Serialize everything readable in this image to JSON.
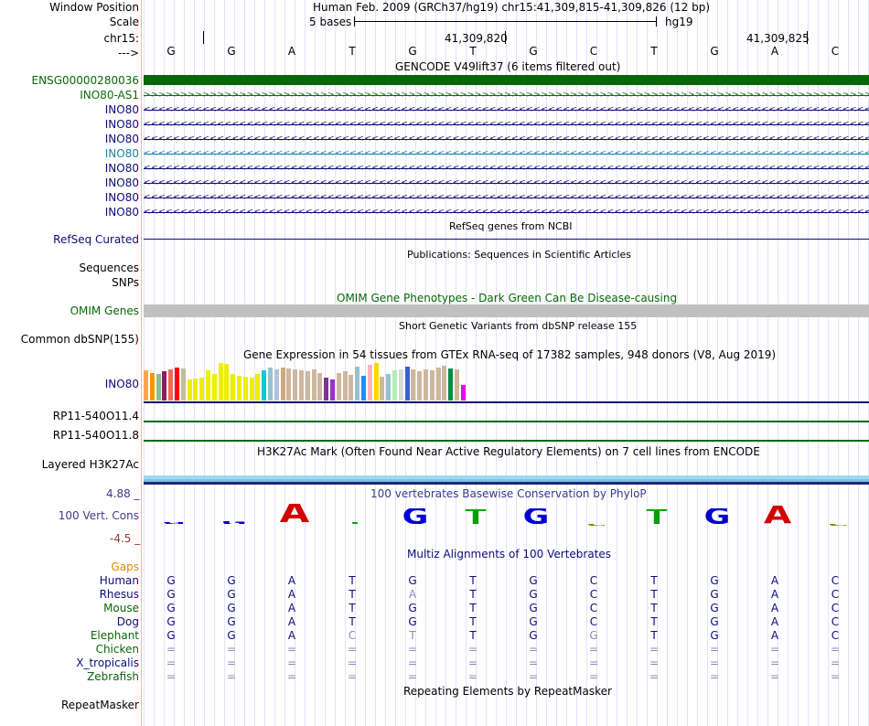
{
  "header": {
    "window_position_label": "Window Position",
    "scale_label": "Scale",
    "chrom_label": "chr15:",
    "arrow_label": "--->",
    "title": "Human Feb. 2009 (GRCh37/hg19)   chr15:41,309,815-41,309,826 (12 bp)",
    "scale_text": "5 bases",
    "assembly": "hg19",
    "pos1": "41,309,820",
    "pos2": "41,309,825"
  },
  "bases": [
    "G",
    "G",
    "A",
    "T",
    "G",
    "T",
    "G",
    "C",
    "T",
    "G",
    "A",
    "C"
  ],
  "gencode": {
    "title": "GENCODE V49lift37 (6 items filtered out)",
    "rows": [
      {
        "label": "ENSG00000280036",
        "color": "#086708",
        "style": "bar"
      },
      {
        "label": "INO80-AS1",
        "color": "#0c6c0c",
        "style": "fwd"
      },
      {
        "label": "INO80",
        "color": "#0c0c78",
        "style": "rev"
      },
      {
        "label": "INO80",
        "color": "#0c0c78",
        "style": "rev"
      },
      {
        "label": "INO80",
        "color": "#0c0c78",
        "style": "rev"
      },
      {
        "label": "INO80",
        "color": "#1686a6",
        "style": "rev"
      },
      {
        "label": "INO80",
        "color": "#0c0c78",
        "style": "rev"
      },
      {
        "label": "INO80",
        "color": "#0c0c78",
        "style": "rev"
      },
      {
        "label": "INO80",
        "color": "#0c0c78",
        "style": "rev"
      },
      {
        "label": "INO80",
        "color": "#0c0c78",
        "style": "rev"
      }
    ]
  },
  "refseq": {
    "title": "RefSeq genes from NCBI",
    "label": "RefSeq Curated"
  },
  "pubs": {
    "title": "Publications: Sequences in Scientific Articles",
    "label1": "Sequences",
    "label2": "SNPs"
  },
  "omim": {
    "title": "OMIM Gene Phenotypes - Dark Green Can Be Disease-causing",
    "label": "OMIM Genes"
  },
  "dbsnp": {
    "title": "Short Genetic Variants from dbSNP release 155",
    "label": "Common dbSNP(155)"
  },
  "gtex": {
    "title": "Gene Expression in 54 tissues from GTEx RNA-seq of 17382 samples, 948 donors (V8, Aug 2019)",
    "label": "INO80",
    "bars": [
      {
        "h": 0.78,
        "c": "#ffa54f"
      },
      {
        "h": 0.72,
        "c": "#ee9a00"
      },
      {
        "h": 0.68,
        "c": "#8fbc8f"
      },
      {
        "h": 0.75,
        "c": "#8b1c62"
      },
      {
        "h": 0.8,
        "c": "#ee6a50"
      },
      {
        "h": 0.85,
        "c": "#ff0000"
      },
      {
        "h": 0.83,
        "c": "#cdb79e"
      },
      {
        "h": 0.55,
        "c": "#eeee00"
      },
      {
        "h": 0.58,
        "c": "#eeee00"
      },
      {
        "h": 0.6,
        "c": "#eeee00"
      },
      {
        "h": 0.78,
        "c": "#eeee00"
      },
      {
        "h": 0.68,
        "c": "#eeee00"
      },
      {
        "h": 0.98,
        "c": "#eeee00"
      },
      {
        "h": 0.95,
        "c": "#eeee00"
      },
      {
        "h": 0.7,
        "c": "#eeee00"
      },
      {
        "h": 0.65,
        "c": "#eeee00"
      },
      {
        "h": 0.62,
        "c": "#eeee00"
      },
      {
        "h": 0.6,
        "c": "#eeee00"
      },
      {
        "h": 0.68,
        "c": "#eeee00"
      },
      {
        "h": 0.78,
        "c": "#00cdcd"
      },
      {
        "h": 0.85,
        "c": "#9ac0cd"
      },
      {
        "h": 0.82,
        "c": "#b0c4de"
      },
      {
        "h": 0.86,
        "c": "#cdaa7d"
      },
      {
        "h": 0.84,
        "c": "#cdb79e"
      },
      {
        "h": 0.8,
        "c": "#cdb79e"
      },
      {
        "h": 0.78,
        "c": "#cdb79e"
      },
      {
        "h": 0.76,
        "c": "#cdb79e"
      },
      {
        "h": 0.8,
        "c": "#cdb79e"
      },
      {
        "h": 0.72,
        "c": "#cdb79e"
      },
      {
        "h": 0.6,
        "c": "#7a378b"
      },
      {
        "h": 0.55,
        "c": "#9a32cd"
      },
      {
        "h": 0.72,
        "c": "#cdb79e"
      },
      {
        "h": 0.76,
        "c": "#cdb79e"
      },
      {
        "h": 0.66,
        "c": "#cdb79e"
      },
      {
        "h": 0.88,
        "c": "#9ac0cd"
      },
      {
        "h": 0.65,
        "c": "#1e90ff"
      },
      {
        "h": 0.92,
        "c": "#ffb6c1"
      },
      {
        "h": 0.98,
        "c": "#ffd700"
      },
      {
        "h": 0.62,
        "c": "#cdb79e"
      },
      {
        "h": 0.7,
        "c": "#9ac0cd"
      },
      {
        "h": 0.78,
        "c": "#b4eeb4"
      },
      {
        "h": 0.82,
        "c": "#d9d9d9"
      },
      {
        "h": 0.88,
        "c": "#3a5fcd"
      },
      {
        "h": 0.8,
        "c": "#cdb79e"
      },
      {
        "h": 0.76,
        "c": "#cdb79e"
      },
      {
        "h": 0.8,
        "c": "#cdb79e"
      },
      {
        "h": 0.78,
        "c": "#cdb79e"
      },
      {
        "h": 0.85,
        "c": "#cdb79e"
      },
      {
        "h": 0.9,
        "c": "#cdb79e"
      },
      {
        "h": 0.84,
        "c": "#008b45"
      },
      {
        "h": 0.82,
        "c": "#cdb79e"
      },
      {
        "h": 0.4,
        "c": "#ee00ee"
      }
    ]
  },
  "rp11": {
    "label1": "RP11-540O11.4",
    "label2": "RP11-540O11.8"
  },
  "h3k27ac": {
    "title": "H3K27Ac Mark (Often Found Near Active Regulatory Elements) on 7 cell lines from ENCODE",
    "label": "Layered H3K27Ac"
  },
  "phylop": {
    "title": "100 vertebrates Basewise Conservation by PhyloP",
    "label": "100 Vert. Cons",
    "max": "4.88 _",
    "min": "-4.5 _",
    "scores": [
      0.08,
      0.12,
      1.0,
      0.05,
      0.75,
      0.72,
      0.75,
      -0.08,
      0.72,
      0.75,
      0.9,
      -0.1
    ],
    "colors": [
      "#0000d2",
      "#0000d2",
      "#d20000",
      "#00a000",
      "#0000d2",
      "#00a000",
      "#0000d2",
      "#888800",
      "#00a000",
      "#0000d2",
      "#d20000",
      "#888800"
    ]
  },
  "multiz": {
    "title": "Multiz Alignments of 100 Vertebrates",
    "gaps_label": "Gaps",
    "species": [
      {
        "name": "Human",
        "color": "#0c0c78",
        "seq": [
          "G",
          "G",
          "A",
          "T",
          "G",
          "T",
          "G",
          "C",
          "T",
          "G",
          "A",
          "C"
        ],
        "light": []
      },
      {
        "name": "Rhesus",
        "color": "#0c0c78",
        "seq": [
          "G",
          "G",
          "A",
          "T",
          "A",
          "T",
          "G",
          "C",
          "T",
          "G",
          "A",
          "C"
        ],
        "light": [
          4
        ]
      },
      {
        "name": "Mouse",
        "color": "#086708",
        "seq": [
          "G",
          "G",
          "A",
          "T",
          "G",
          "T",
          "G",
          "C",
          "T",
          "G",
          "A",
          "C"
        ],
        "light": []
      },
      {
        "name": "Dog",
        "color": "#0c0c78",
        "seq": [
          "G",
          "G",
          "A",
          "T",
          "G",
          "T",
          "G",
          "C",
          "T",
          "G",
          "A",
          "C"
        ],
        "light": []
      },
      {
        "name": "Elephant",
        "color": "#086708",
        "seq": [
          "G",
          "G",
          "A",
          "C",
          "T",
          "T",
          "G",
          "G",
          "T",
          "G",
          "A",
          "C"
        ],
        "light": [
          3,
          4,
          7
        ]
      },
      {
        "name": "Chicken",
        "color": "#086708",
        "seq": [
          "=",
          "=",
          "=",
          "=",
          "=",
          "=",
          "=",
          "=",
          "=",
          "=",
          "=",
          "="
        ],
        "light": [
          0,
          1,
          2,
          3,
          4,
          5,
          6,
          7,
          8,
          9,
          10,
          11
        ]
      },
      {
        "name": "X_tropicalis",
        "color": "#0c0c78",
        "seq": [
          "=",
          "=",
          "=",
          "=",
          "=",
          "=",
          "=",
          "=",
          "=",
          "=",
          "=",
          "="
        ],
        "light": [
          0,
          1,
          2,
          3,
          4,
          5,
          6,
          7,
          8,
          9,
          10,
          11
        ]
      },
      {
        "name": "Zebrafish",
        "color": "#086708",
        "seq": [
          "=",
          "=",
          "=",
          "=",
          "=",
          "=",
          "=",
          "=",
          "=",
          "=",
          "=",
          "="
        ],
        "light": [
          0,
          1,
          2,
          3,
          4,
          5,
          6,
          7,
          8,
          9,
          10,
          11
        ]
      }
    ]
  },
  "repeat": {
    "title": "Repeating Elements by RepeatMasker",
    "label": "RepeatMasker"
  }
}
